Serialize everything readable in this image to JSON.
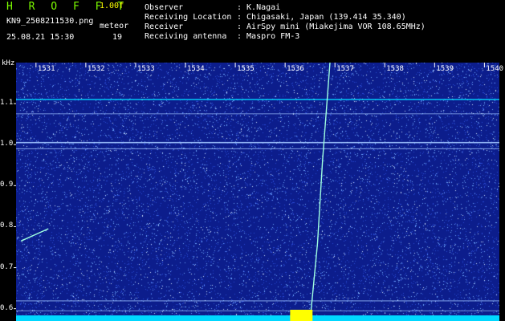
{
  "header": {
    "app_title": "H R O F F T",
    "version": "1.00f",
    "filename": "KN9_2508211530.png",
    "mode": "meteor",
    "datetime": "25.08.21 15:30",
    "count": "19"
  },
  "station_info": [
    {
      "label": "Observer",
      "value": ": K.Nagai"
    },
    {
      "label": "Receiving Location",
      "value": ": Chigasaki, Japan (139.414 35.340)"
    },
    {
      "label": "Receiver",
      "value": ": AirSpy mini (Miakejima VOR 108.65MHz)"
    },
    {
      "label": "Receiving antenna",
      "value": ": Maspro FM-3"
    }
  ],
  "colors": {
    "background": "#0c1d8c",
    "noise": "#6fa8ff",
    "echo": "#9fffe0",
    "baseline": "#00d8ff",
    "overload": "#ffff00",
    "text_green": "#7CFC00",
    "text_yellow": "#ffff00"
  },
  "chart_data": {
    "type": "heatmap",
    "ylabel": "kHz",
    "ylim": [
      0.57,
      1.2
    ],
    "y_ticks": [
      0.6,
      0.7,
      0.8,
      0.9,
      1.0,
      1.1
    ],
    "y_tick_labels": [
      "0.6",
      "0.7",
      "0.8",
      "0.9",
      "1.0",
      "1.1"
    ],
    "xlim": [
      1530.6,
      1540.3
    ],
    "x_ticks": [
      1531,
      1532,
      1533,
      1534,
      1535,
      1536,
      1537,
      1538,
      1539,
      1540
    ],
    "x_tick_labels": [
      "1531",
      "1532",
      "1533",
      "1534",
      "1535",
      "1536",
      "1537",
      "1538",
      "1539",
      "1540"
    ],
    "carrier_lines_khz": [
      1.11,
      1.075,
      1.005,
      0.99,
      0.619,
      0.595
    ],
    "overload_band": [
      1536.1,
      1536.55
    ],
    "traces": [
      {
        "points": [
          [
            1536.5,
            0.57
          ],
          [
            1536.65,
            0.76
          ],
          [
            1536.75,
            0.96
          ],
          [
            1536.9,
            1.2
          ]
        ]
      },
      {
        "points": [
          [
            1530.7,
            0.765
          ],
          [
            1531.25,
            0.795
          ]
        ]
      }
    ]
  }
}
